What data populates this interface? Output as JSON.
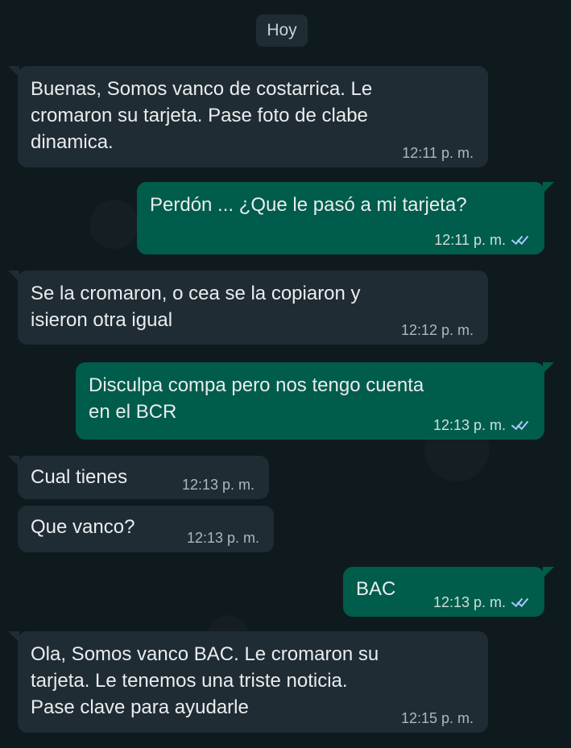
{
  "date_chip": "Hoy",
  "messages": [
    {
      "direction": "incoming",
      "text": "Buenas, Somos vanco de costarrica. Le\ncromaron su tarjeta. Pase foto de clabe\ndinamica.",
      "time": "12:11 p. m."
    },
    {
      "direction": "outgoing",
      "text": "Perdón ... ¿Que le pasó a mi tarjeta?",
      "time": "12:11 p. m.",
      "status": "read"
    },
    {
      "direction": "incoming",
      "text": "Se la cromaron, o cea se la copiaron y\nisieron otra igual",
      "time": "12:12 p. m."
    },
    {
      "direction": "outgoing",
      "text": "Disculpa compa pero nos tengo cuenta\nen el BCR",
      "time": "12:13 p. m.",
      "status": "read"
    },
    {
      "direction": "incoming",
      "text": "Cual tienes",
      "time": "12:13 p. m."
    },
    {
      "direction": "incoming",
      "text": "Que vanco?",
      "time": "12:13 p. m."
    },
    {
      "direction": "outgoing",
      "text": "BAC",
      "time": "12:13 p. m.",
      "status": "read"
    },
    {
      "direction": "incoming",
      "text": "Ola, Somos vanco BAC. Le cromaron su\ntarjeta. Le tenemos una triste noticia.\nPase clave para ayudarle",
      "time": "12:15 p. m."
    }
  ],
  "colors": {
    "background": "#0b141a",
    "incoming_bubble": "#202c33",
    "outgoing_bubble": "#005c4b",
    "read_ticks": "#a7c9ff"
  },
  "icons": {
    "read_receipt": "double-check-icon"
  }
}
